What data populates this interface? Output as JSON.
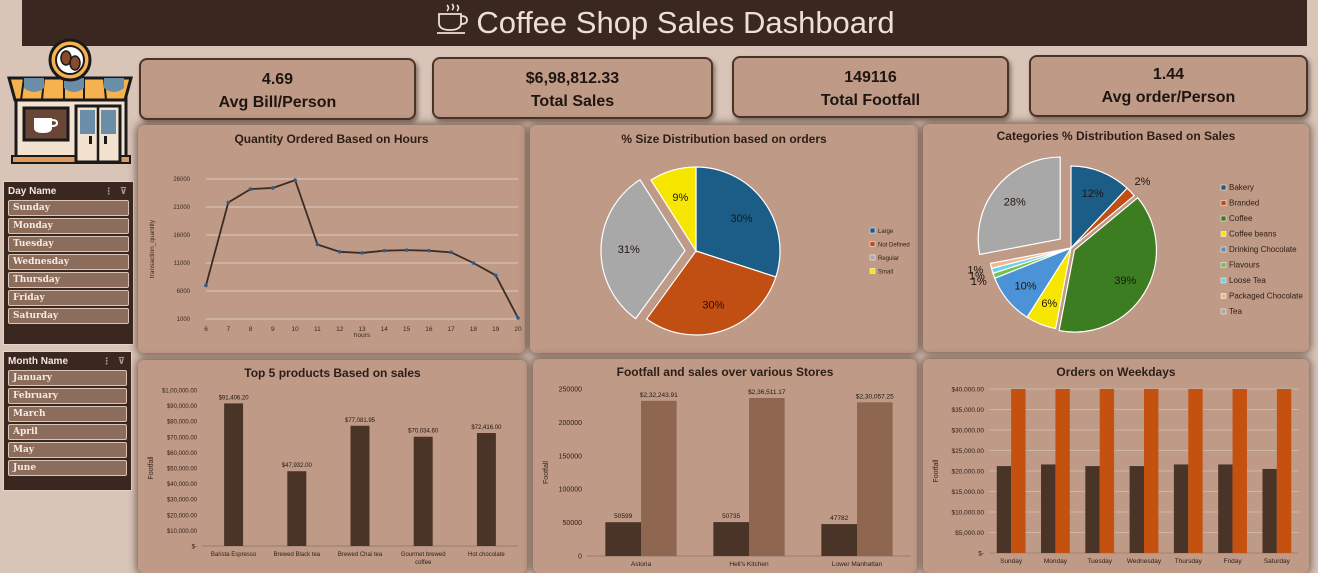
{
  "header": {
    "title": "Coffee Shop Sales Dashboard",
    "cup_icon": "coffee-cup-icon"
  },
  "logo": {
    "icon": "coffee-shop-storefront-icon"
  },
  "kpis": [
    {
      "value": "4.69",
      "label": "Avg Bill/Person"
    },
    {
      "value": "$6,98,812.33",
      "label": "Total Sales"
    },
    {
      "value": "149116",
      "label": "Total Footfall"
    },
    {
      "value": "1.44",
      "label": "Avg order/Person"
    }
  ],
  "day_slicer": {
    "title": "Day Name",
    "items": [
      "Sunday",
      "Monday",
      "Tuesday",
      "Wednesday",
      "Thursday",
      "Friday",
      "Saturday"
    ]
  },
  "month_slicer": {
    "title": "Month Name",
    "items": [
      "January",
      "February",
      "March",
      "April",
      "May",
      "June"
    ]
  },
  "colors": {
    "dark_brown": "#3a2820",
    "panel": "#bf9a87",
    "bar_dark": "#4a3428",
    "bar_light": "#8f6650",
    "bar_orange": "#c4510f",
    "line": "#3b2c25"
  },
  "chart_data": [
    {
      "type": "line",
      "title": "Quantity Ordered Based on Hours",
      "xlabel": "hours",
      "ylabel": "transaction_quantity",
      "x": [
        6,
        7,
        8,
        9,
        10,
        11,
        12,
        13,
        14,
        15,
        16,
        17,
        18,
        19,
        20
      ],
      "yticks": [
        "1000",
        "6000",
        "11000",
        "16000",
        "21000",
        "26000"
      ],
      "ylim": [
        1000,
        26000
      ],
      "series": [
        {
          "values": [
            7000,
            21800,
            24200,
            24400,
            25800,
            14300,
            13000,
            12800,
            13200,
            13300,
            13200,
            12900,
            11000,
            8800,
            1200
          ]
        }
      ]
    },
    {
      "type": "pie",
      "title": "% Size Distribution based on orders",
      "slices": [
        {
          "name": "Large",
          "value": 30,
          "label": "30%",
          "color": "#1b5d86"
        },
        {
          "name": "Not Defined",
          "value": 30,
          "label": "30%",
          "color": "#c14e12"
        },
        {
          "name": "Regular",
          "value": 31,
          "label": "31%",
          "color": "#a8a8a8"
        },
        {
          "name": "Small",
          "value": 9,
          "label": "9%",
          "color": "#f7e600"
        }
      ]
    },
    {
      "type": "pie",
      "title": "Categories % Distribution Based on Sales",
      "slices": [
        {
          "name": "Bakery",
          "value": 12,
          "label": "12%",
          "color": "#1b5d86"
        },
        {
          "name": "Branded",
          "value": 2,
          "label": "2%",
          "color": "#c14e12"
        },
        {
          "name": "Coffee",
          "value": 39,
          "label": "39%",
          "color": "#3d7d22"
        },
        {
          "name": "Coffee beans",
          "value": 6,
          "label": "6%",
          "color": "#f7e600"
        },
        {
          "name": "Drinking Chocolate",
          "value": 10,
          "label": "10%",
          "color": "#4b93d6"
        },
        {
          "name": "Flavours",
          "value": 1,
          "label": "1%",
          "color": "#73c24d"
        },
        {
          "name": "Loose Tea",
          "value": 1,
          "label": "1%",
          "color": "#6fd0ec"
        },
        {
          "name": "Packaged Chocolate",
          "value": 1,
          "label": "1%",
          "color": "#f0b88c"
        },
        {
          "name": "Tea",
          "value": 28,
          "label": "28%",
          "color": "#a8a8a8"
        }
      ]
    },
    {
      "type": "bar",
      "title": "Top 5 products Based on sales",
      "ylabel": "Footfall",
      "categories": [
        "Barista Espresso",
        "Brewed Black tea",
        "Brewed Chai tea",
        "Gourmet brewed coffee",
        "Hot chocolate"
      ],
      "values": [
        91406.2,
        47932,
        77081.95,
        70034.6,
        72416
      ],
      "data_labels": [
        "$91,406.20",
        "$47,932.00",
        "$77,081.95",
        "$70,034.60",
        "$72,416.00"
      ],
      "yticks": [
        "$-",
        "$10,000.00",
        "$20,000.00",
        "$30,000.00",
        "$40,000.00",
        "$50,000.00",
        "$60,000.00",
        "$70,000.00",
        "$80,000.00",
        "$90,000.00",
        "$1,00,000.00"
      ],
      "ylim": [
        0,
        100000
      ]
    },
    {
      "type": "bar",
      "title": "Footfall and sales over various Stores",
      "ylabel": "Footfall",
      "categories": [
        "Astoria",
        "Hell's Kitchen",
        "Lower Manhattan"
      ],
      "series": [
        {
          "values": [
            50599,
            50735,
            47782
          ],
          "labels": [
            "50599",
            "50735",
            "47782"
          ]
        },
        {
          "values": [
            232243.91,
            236511.17,
            230057.25
          ],
          "labels": [
            "$2,32,243.91",
            "$2,36,511.17",
            "$2,30,057.25"
          ]
        }
      ],
      "yticks": [
        "0",
        "50000",
        "100000",
        "150000",
        "200000",
        "250000"
      ],
      "ylim": [
        0,
        250000
      ]
    },
    {
      "type": "bar",
      "title": "Orders on Weekdays",
      "ylabel": "Footfall",
      "categories": [
        "Sunday",
        "Monday",
        "Tuesday",
        "Wednesday",
        "Thursday",
        "Friday",
        "Saturday"
      ],
      "series": [
        {
          "values": [
            21200,
            21600,
            21200,
            21200,
            21600,
            21600,
            20500
          ]
        },
        {
          "values": [
            40000,
            40000,
            40000,
            40000,
            40000,
            40000,
            40000
          ]
        }
      ],
      "yticks": [
        "$-",
        "$5,000.00",
        "$10,000.00",
        "$15,000.00",
        "$20,000.00",
        "$25,000.00",
        "$30,000.00",
        "$35,000.00",
        "$40,000.00"
      ],
      "ylim": [
        0,
        40000
      ]
    }
  ]
}
